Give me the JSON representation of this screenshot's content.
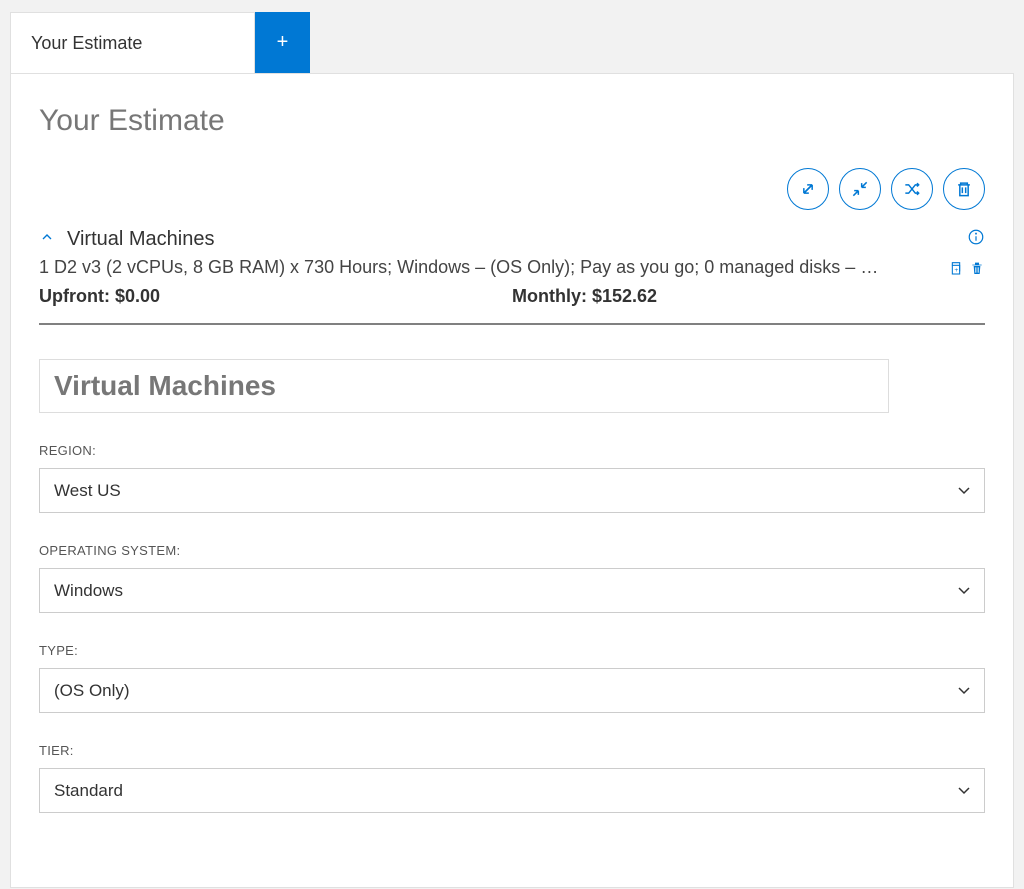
{
  "tabs": {
    "active_label": "Your Estimate",
    "add_label": "+"
  },
  "page_title": "Your Estimate",
  "item": {
    "title": "Virtual Machines",
    "description": "1 D2 v3 (2 vCPUs, 8 GB RAM) x 730 Hours; Windows – (OS Only); Pay as you go; 0 managed disks – …",
    "upfront_label": "Upfront: $0.00",
    "monthly_label": "Monthly: $152.62"
  },
  "service_name": "Virtual Machines",
  "form": {
    "region": {
      "label": "REGION:",
      "value": "West US"
    },
    "os": {
      "label": "OPERATING SYSTEM:",
      "value": "Windows"
    },
    "type": {
      "label": "TYPE:",
      "value": "(OS Only)"
    },
    "tier": {
      "label": "TIER:",
      "value": "Standard"
    }
  }
}
